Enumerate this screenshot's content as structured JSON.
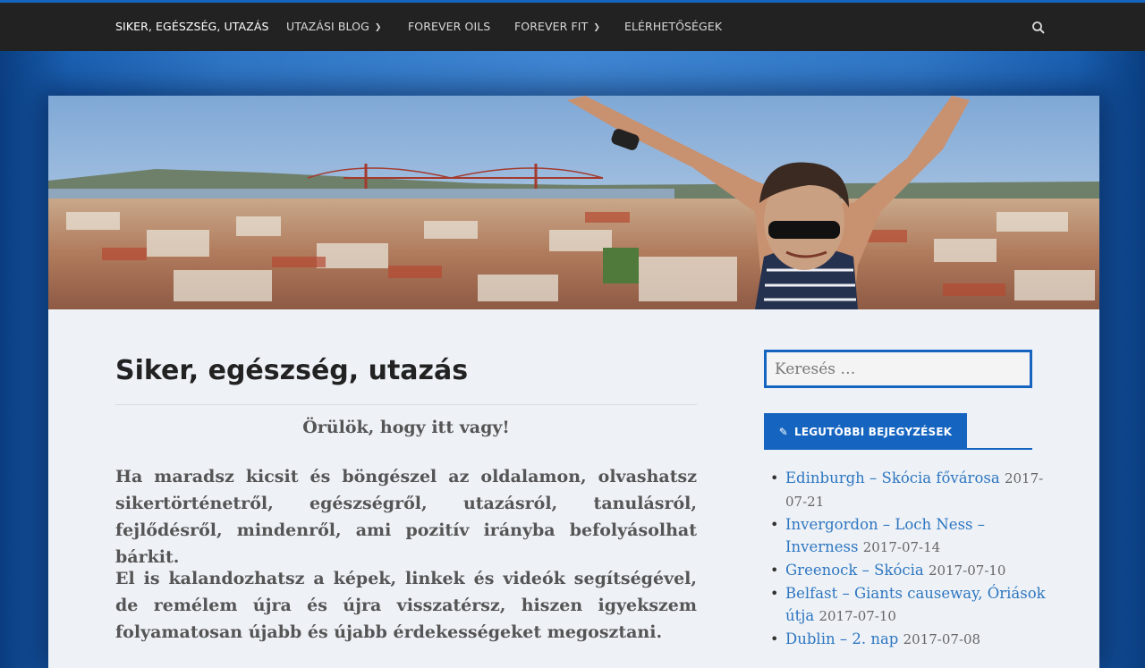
{
  "nav": {
    "brand": "SIKER, EGÉSZSÉG, UTAZÁS",
    "items": [
      {
        "label": "UTAZÁSI BLOG",
        "has_dropdown": true
      },
      {
        "label": "FOREVER OILS",
        "has_dropdown": false
      },
      {
        "label": "FOREVER FIT",
        "has_dropdown": true
      },
      {
        "label": "ELÉRHETŐSÉGEK",
        "has_dropdown": false
      }
    ],
    "search_icon": "search-icon"
  },
  "main": {
    "title": "Siker, egészség, utazás",
    "greeting": "Örülök, hogy itt vagy!",
    "paragraphs": [
      "Ha maradsz kicsit és böngészel az oldalamon, olvashatsz sikertörténetről, egészségről, utazásról, tanulásról, fejlődésről, mindenről, ami pozitív irányba befolyásolhat bárkit.",
      "El is kalandozhatsz a képek, linkek és videók segítségével, de remélem újra és újra visszatérsz, hiszen igyekszem folyamatosan újabb és újabb érdekességeket megosztani."
    ]
  },
  "sidebar": {
    "search_placeholder": "Keresés …",
    "recent_title": "LEGUTÓBBI BEJEGYZÉSEK",
    "recent_icon": "pencil-icon",
    "posts": [
      {
        "title": "Edinburgh – Skócia fővárosa",
        "date": "2017-07-21"
      },
      {
        "title": "Invergordon – Loch Ness – Inverness",
        "date": "2017-07-14"
      },
      {
        "title": "Greenock – Skócia",
        "date": "2017-07-10"
      },
      {
        "title": "Belfast – Giants causeway, Óriások útja",
        "date": "2017-07-10"
      },
      {
        "title": "Dublin – 2. nap",
        "date": "2017-07-08"
      }
    ]
  },
  "colors": {
    "accent": "#1565c0",
    "nav_bg": "#222222",
    "link": "#2e76c0",
    "content_bg": "#eef2f7"
  }
}
